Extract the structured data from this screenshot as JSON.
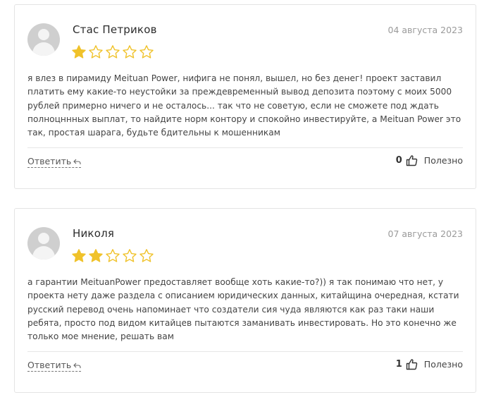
{
  "colors": {
    "star_filled": "#f0c22a",
    "star_empty_outline": "#f0c22a",
    "card_border": "#e4e4e4",
    "text": "#444444",
    "date": "#9a9a9a"
  },
  "icons": {
    "avatar": "user-avatar-icon",
    "star": "star-icon",
    "reply": "reply-arrow-icon",
    "like": "thumbs-up-icon"
  },
  "reviews": [
    {
      "author": "Стас Петриков",
      "date": "04 августа 2023",
      "rating": 1,
      "max_rating": 5,
      "text": "я влез в пирамиду Meituan Power, нифига не понял, вышел, но без денег! проект заставил платить ему какие-то неустойки за преждевременный вывод депозита поэтому с моих 5000 рублей примерно ничего и не осталось... так что не советую, если не сможете под ждать полноцннных выплат, то найдите норм контору и спокойно инвестируйте, а Meituan Power это так, простая шарага, будьте бдительны к мошенникам",
      "reply_label": "Ответить",
      "likes": "0",
      "useful_label": "Полезно"
    },
    {
      "author": "Николя",
      "date": "07 августа 2023",
      "rating": 2,
      "max_rating": 5,
      "text": "а гарантии MeituanPower предоставляет вообще хоть какие-то?)) я так понимаю что нет, у проекта нету даже раздела с описанием юридических данных, китайщина очередная, кстати русский перевод очень напоминает что создатели сия чуда являются как раз таки наши ребята, просто под видом китайцев пытаются заманивать инвестировать. Но это конечно же только мое мнение, решать вам",
      "reply_label": "Ответить",
      "likes": "1",
      "useful_label": "Полезно"
    }
  ]
}
